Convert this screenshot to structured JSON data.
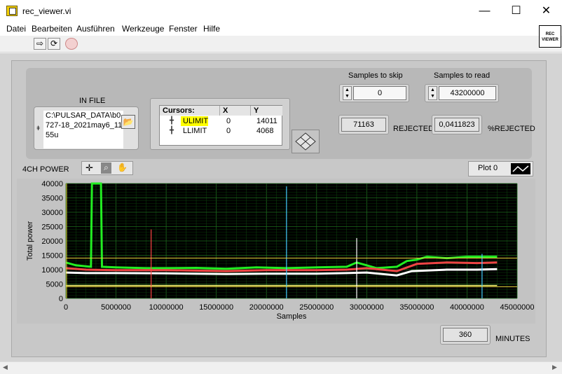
{
  "window": {
    "title": "rec_viewer.vi",
    "minimize": "—",
    "maximize": "☐",
    "close": "✕"
  },
  "menu": [
    "Datei",
    "Bearbeiten",
    "Ausführen",
    "Werkzeuge",
    "Fenster",
    "Hilfe"
  ],
  "toolbar": {
    "run_icon": "run-arrow-icon",
    "run_cont_icon": "run-continuously-icon",
    "abort_icon": "abort-icon"
  },
  "vi_icon": {
    "line1": "REC",
    "line2": "VIEWER"
  },
  "controls": {
    "in_file_label": "IN FILE",
    "in_file_value": "C:\\PULSAR_DATA\\b0727-18_2021may6_1155u",
    "samples_to_skip_label": "Samples to skip",
    "samples_to_skip": "0",
    "samples_to_read_label": "Samples to read",
    "samples_to_read": "43200000",
    "rejected_count": "71163",
    "rejected_label": "REJECTED",
    "rejected_pct": "0,0411823",
    "rejected_pct_label": "%REJECTED",
    "minutes": "360",
    "minutes_label": "MINUTES"
  },
  "cursors": {
    "headers": [
      "Cursors:",
      "X",
      "Y"
    ],
    "rows": [
      {
        "name": "ULIMIT",
        "x": "0",
        "y": "14011",
        "highlight": "#ffff00"
      },
      {
        "name": "LLIMIT",
        "x": "0",
        "y": "4068"
      }
    ]
  },
  "graph": {
    "label": "4CH POWER",
    "legend": "Plot 0"
  },
  "chart_data": {
    "type": "line",
    "title": "4CH POWER",
    "xlabel": "Samples",
    "ylabel": "Total power",
    "xlim": [
      0,
      45000000
    ],
    "ylim": [
      0,
      40000
    ],
    "x_ticks": [
      "0",
      "5000000",
      "10000000",
      "15000000",
      "20000000",
      "25000000",
      "30000000",
      "35000000",
      "40000000",
      "45000000"
    ],
    "y_ticks": [
      "0",
      "5000",
      "10000",
      "15000",
      "20000",
      "25000",
      "30000",
      "35000",
      "40000"
    ],
    "grid": true,
    "background": "#000000",
    "cursor_lines": [
      {
        "name": "ULIMIT",
        "y": 14011,
        "color": "#e8d23a"
      },
      {
        "name": "LLIMIT",
        "y": 4068,
        "color": "#e8d23a"
      }
    ],
    "series": [
      {
        "color": "#22ee22",
        "x": [
          0,
          1000000,
          2500000,
          2600000,
          3500000,
          3600000,
          5000000,
          8000000,
          10000000,
          13000000,
          16000000,
          19000000,
          22000000,
          25000000,
          28000000,
          29000000,
          30000000,
          31000000,
          33000000,
          34000000,
          35000000,
          36000000,
          38000000,
          40000000,
          43000000
        ],
        "y": [
          12500,
          11500,
          11000,
          40000,
          40000,
          11000,
          10800,
          10500,
          10500,
          10600,
          10300,
          10800,
          10500,
          10800,
          11000,
          12500,
          11500,
          10500,
          11000,
          13000,
          13500,
          14500,
          14000,
          14500,
          14500
        ]
      },
      {
        "color": "#ee4444",
        "x": [
          0,
          2000000,
          5000000,
          10000000,
          16000000,
          20000000,
          25000000,
          28000000,
          30000000,
          33000000,
          35000000,
          38000000,
          41000000,
          43000000
        ],
        "y": [
          10500,
          10000,
          9800,
          9800,
          9500,
          9800,
          9800,
          10000,
          10500,
          9500,
          12000,
          12500,
          12300,
          12500
        ]
      },
      {
        "color": "#ffffff",
        "x": [
          0,
          2000000,
          5000000,
          10000000,
          16000000,
          20000000,
          25000000,
          28000000,
          30000000,
          33000000,
          34500000,
          38000000,
          41000000,
          43000000
        ],
        "y": [
          9000,
          8800,
          8800,
          8700,
          8500,
          8600,
          8600,
          8800,
          9000,
          8000,
          9500,
          10000,
          10000,
          10200
        ]
      },
      {
        "color": "#ffff77",
        "x": [
          0,
          43000000
        ],
        "y": [
          4500,
          4500
        ]
      }
    ],
    "spikes": [
      {
        "x": 8500000,
        "y": 24000,
        "color": "#ff4444"
      },
      {
        "x": 22000000,
        "y": 39000,
        "color": "#44ccff"
      },
      {
        "x": 29000000,
        "y": 21000,
        "color": "#ffffff"
      },
      {
        "x": 41500000,
        "y": 15500,
        "color": "#44ccff"
      }
    ]
  }
}
